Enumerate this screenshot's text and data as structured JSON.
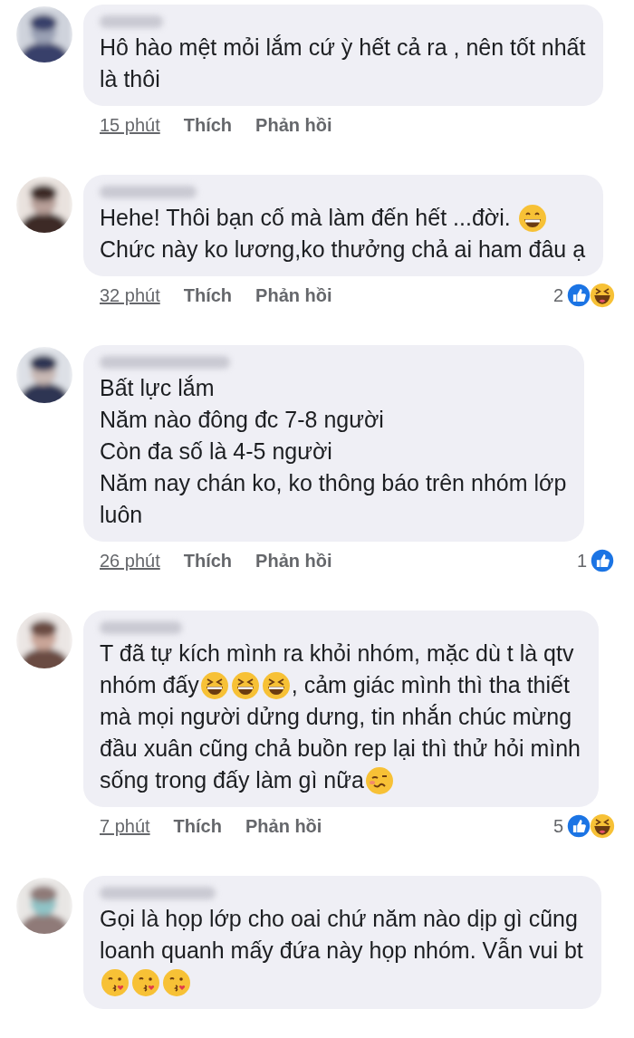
{
  "comments": [
    {
      "avatar": {
        "kind": "picture"
      },
      "lines": [
        [
          {
            "kind": "text",
            "text": "Hô hào mệt mỏi lắm cứ ỳ hết cả ra , nên tốt nhất"
          }
        ],
        [
          {
            "kind": "text",
            "text": "là thôi"
          }
        ]
      ],
      "time": "15 phút",
      "like_label": "Thích",
      "reply_label": "Phản hồi"
    },
    {
      "avatar": {
        "kind": "picture"
      },
      "lines": [
        [
          {
            "kind": "text",
            "text": "Hehe! Thôi bạn cố mà làm đến hết ...đời. "
          },
          {
            "kind": "grin"
          }
        ],
        [
          {
            "kind": "text",
            "text": "Chức này ko lương,ko thưởng chả ai ham đâu ạ"
          }
        ]
      ],
      "time": "32 phút",
      "like_label": "Thích",
      "reply_label": "Phản hồi",
      "reactions": {
        "count": "2",
        "items": [
          {
            "kind": "like"
          },
          {
            "kind": "haha"
          }
        ]
      }
    },
    {
      "avatar": {
        "kind": "picture"
      },
      "lines": [
        [
          {
            "kind": "text",
            "text": "Bất lực lắm"
          }
        ],
        [
          {
            "kind": "text",
            "text": "Năm nào đông đc 7-8 người"
          }
        ],
        [
          {
            "kind": "text",
            "text": "Còn đa số là 4-5 người"
          }
        ],
        [
          {
            "kind": "text",
            "text": "Năm nay chán ko, ko thông báo trên nhóm lớp"
          }
        ],
        [
          {
            "kind": "text",
            "text": "luôn"
          }
        ]
      ],
      "time": "26 phút",
      "like_label": "Thích",
      "reply_label": "Phản hồi",
      "reactions": {
        "count": "1",
        "items": [
          {
            "kind": "like"
          }
        ]
      }
    },
    {
      "avatar": {
        "kind": "picture"
      },
      "lines": [
        [
          {
            "kind": "text",
            "text": "T đã tự kích mình ra khỏi nhóm, mặc dù t là qtv"
          }
        ],
        [
          {
            "kind": "text",
            "text": "nhóm đấy"
          },
          {
            "kind": "laugh"
          },
          {
            "kind": "laugh"
          },
          {
            "kind": "laugh"
          },
          {
            "kind": "text",
            "text": ", cảm giác mình thì tha thiết"
          }
        ],
        [
          {
            "kind": "text",
            "text": "mà mọi người dửng dưng, tin nhắn chúc mừng"
          }
        ],
        [
          {
            "kind": "text",
            "text": "đầu xuân cũng chả buồn rep lại thì thử hỏi mình"
          }
        ],
        [
          {
            "kind": "text",
            "text": "sống trong đấy làm gì nữa"
          },
          {
            "kind": "woozy"
          }
        ]
      ],
      "time": "7 phút",
      "like_label": "Thích",
      "reply_label": "Phản hồi",
      "reactions": {
        "count": "5",
        "items": [
          {
            "kind": "like"
          },
          {
            "kind": "haha"
          }
        ]
      }
    },
    {
      "avatar": {
        "kind": "picture"
      },
      "lines": [
        [
          {
            "kind": "text",
            "text": "Gọi là họp lớp cho oai chứ năm nào dịp gì cũng"
          }
        ],
        [
          {
            "kind": "text",
            "text": "loanh quanh mấy đứa này họp nhóm. Vẫn vui bt"
          }
        ],
        [
          {
            "kind": "kiss"
          },
          {
            "kind": "kiss"
          },
          {
            "kind": "kiss"
          }
        ]
      ]
    }
  ]
}
